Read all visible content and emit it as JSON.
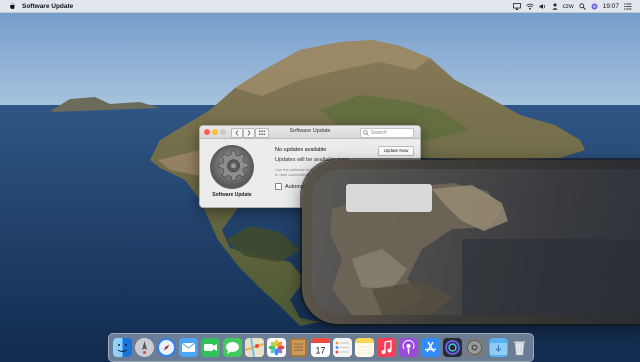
{
  "menubar": {
    "app_name": "Software Update",
    "user": "czw",
    "time": "19:07"
  },
  "window": {
    "title": "Software Update",
    "search_placeholder": "Search",
    "panel_caption": "Software Update",
    "status_line_1": "No updates available",
    "status_line_2": "Updates will be available soon",
    "status_line_3": "Use the software to keep your Mac up to date automatically",
    "update_button": "Update Now",
    "auto_label": "Automatically",
    "colors": {
      "close": "#ff5f57",
      "minimize": "#febc2e",
      "zoom": "#c8c8c8"
    }
  },
  "dock": {
    "icons": [
      {
        "name": "finder-icon",
        "color": "#2a8cf0"
      },
      {
        "name": "launchpad-icon",
        "color": "#c9ccd2"
      },
      {
        "name": "safari-icon",
        "color": "#2f80ed"
      },
      {
        "name": "mail-icon",
        "color": "#4aa6f5"
      },
      {
        "name": "facetime-icon",
        "color": "#2fc25b"
      },
      {
        "name": "messages-icon",
        "color": "#43c95b"
      },
      {
        "name": "maps-icon",
        "color": "#6fbf73"
      },
      {
        "name": "photos-icon",
        "color": "#ffffff"
      },
      {
        "name": "notes-brown-icon",
        "color": "#a5763d"
      },
      {
        "name": "calendar-icon",
        "color": "#ffffff"
      },
      {
        "name": "reminders-icon",
        "color": "#f4f4f4"
      },
      {
        "name": "notes-icon",
        "color": "#f7d65a"
      },
      {
        "name": "music-icon",
        "color": "#fc3c55"
      },
      {
        "name": "podcasts-icon",
        "color": "#9b4bdc"
      },
      {
        "name": "app-store-icon",
        "color": "#2f8cff"
      },
      {
        "name": "screen-time-icon",
        "color": "#2b2b2b"
      },
      {
        "name": "system-preferences-icon",
        "color": "#7a7a7a"
      },
      {
        "name": "downloads-folder-icon",
        "color": "#59b0ef"
      },
      {
        "name": "trash-icon",
        "color": "#dde2e7"
      }
    ]
  }
}
